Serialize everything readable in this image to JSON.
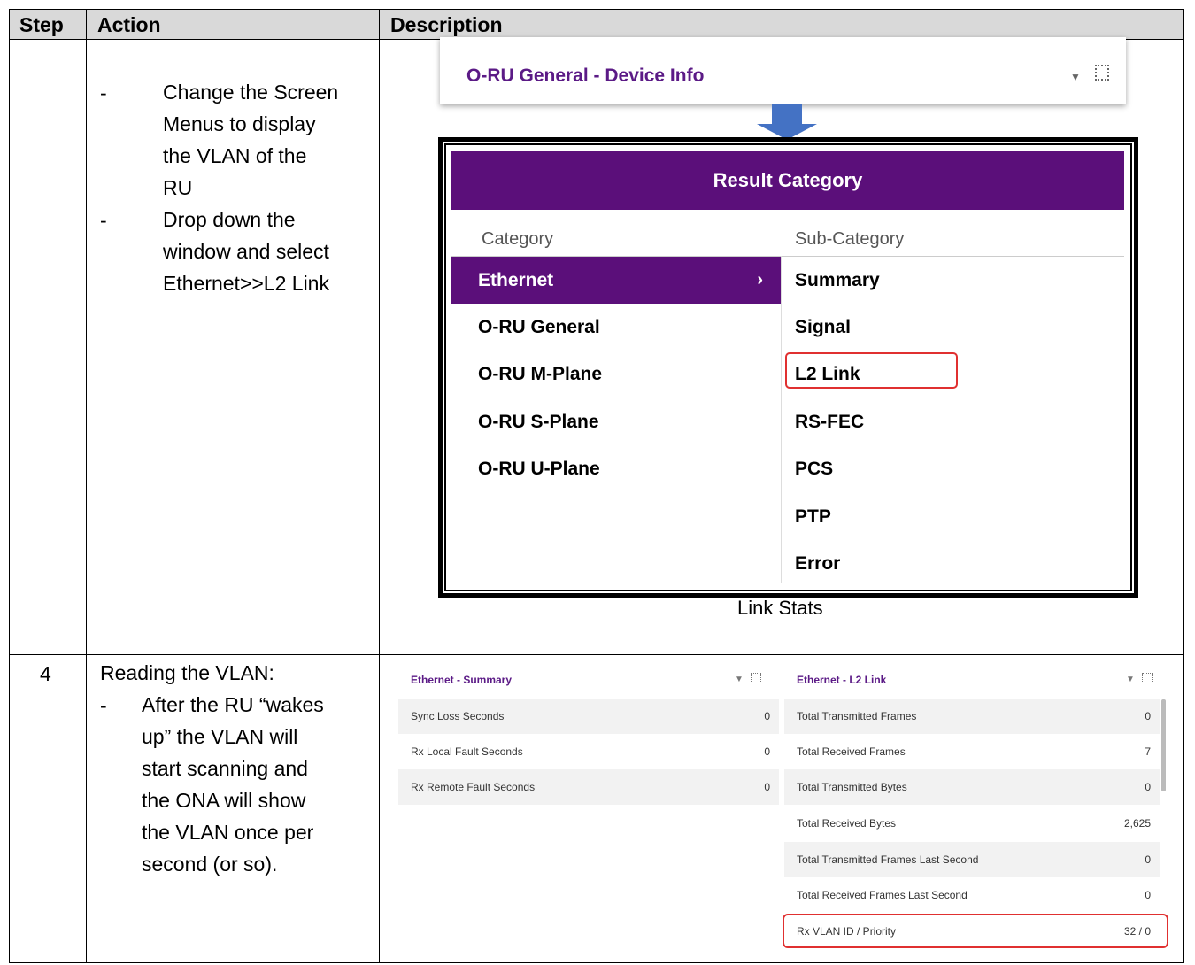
{
  "table": {
    "headers": {
      "step": "Step",
      "action": "Action",
      "description": "Description"
    },
    "row3": {
      "bullets": [
        {
          "dash": "-",
          "lines": [
            "Change the Screen",
            "Menus to display",
            "the VLAN of the",
            "RU"
          ]
        },
        {
          "dash": "-",
          "lines": [
            "Drop down the",
            "window and select",
            "Ethernet>>L2 Link"
          ]
        }
      ],
      "dropdown_title": "O-RU General - Device Info",
      "result_category": {
        "title": "Result Category",
        "col_category": "Category",
        "col_subcategory": "Sub-Category",
        "categories": [
          "Ethernet",
          "O-RU General",
          "O-RU M-Plane",
          "O-RU S-Plane",
          "O-RU U-Plane"
        ],
        "subcategories": [
          "Summary",
          "Signal",
          "L2 Link",
          "RS-FEC",
          "PCS",
          "PTP",
          "Error"
        ],
        "chevron": "›"
      },
      "caption": "Link Stats"
    },
    "row4": {
      "step": "4",
      "intro": "Reading the VLAN:",
      "dash": "-",
      "lines": [
        "After the RU “wakes",
        "up” the VLAN will",
        "start scanning and",
        "the ONA will show",
        "the VLAN once per",
        "second (or so)."
      ],
      "summary_panel": {
        "title": "Ethernet - Summary",
        "rows": [
          {
            "label": "Sync Loss Seconds",
            "value": "0"
          },
          {
            "label": "Rx Local Fault Seconds",
            "value": "0"
          },
          {
            "label": "Rx Remote Fault Seconds",
            "value": "0"
          }
        ]
      },
      "l2_panel": {
        "title": "Ethernet - L2 Link",
        "rows": [
          {
            "label": "Total Transmitted Frames",
            "value": "0"
          },
          {
            "label": "Total Received Frames",
            "value": "7"
          },
          {
            "label": "Total Transmitted Bytes",
            "value": "0"
          },
          {
            "label": "Total Received Bytes",
            "value": "2,625"
          },
          {
            "label": "Total Transmitted Frames Last Second",
            "value": "0"
          },
          {
            "label": "Total Received Frames Last Second",
            "value": "0"
          },
          {
            "label": "Rx VLAN ID / Priority",
            "value": "32 / 0"
          }
        ]
      }
    }
  },
  "colors": {
    "purple": "#5b0f7a",
    "highlight": "#e03030",
    "arrow": "#4472c4",
    "header_gray": "#d9d9d9"
  }
}
